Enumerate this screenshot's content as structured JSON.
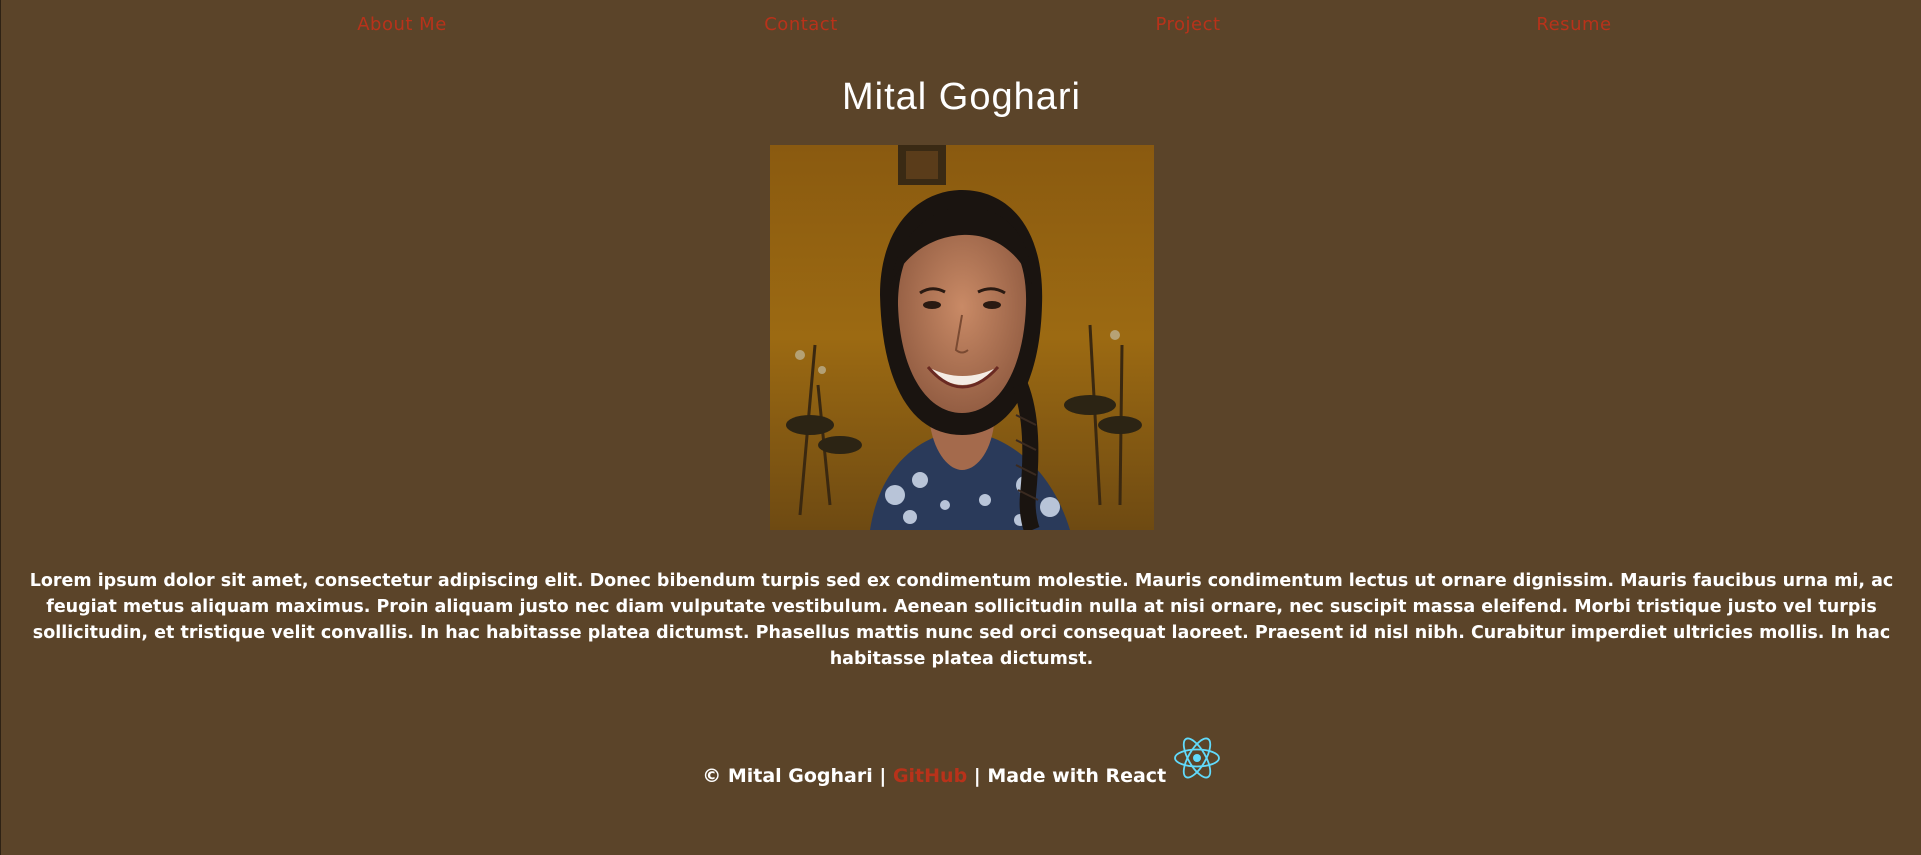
{
  "nav": {
    "items": [
      {
        "label": "About Me"
      },
      {
        "label": "Contact"
      },
      {
        "label": "Project"
      },
      {
        "label": "Resume"
      }
    ],
    "link_color": "#b8321a"
  },
  "header": {
    "title": "Mital Goghari"
  },
  "profile_photo": {
    "alt": "Mital Goghari"
  },
  "main": {
    "bio": "Lorem ipsum dolor sit amet, consectetur adipiscing elit. Donec bibendum turpis sed ex condimentum molestie. Mauris condimentum lectus ut ornare dignissim. Mauris faucibus urna mi, ac feugiat metus aliquam maximus. Proin aliquam justo nec diam vulputate vestibulum. Aenean sollicitudin nulla at nisi ornare, nec suscipit massa eleifend. Morbi tristique justo vel turpis sollicitudin, et tristique velit convallis. In hac habitasse platea dictumst. Phasellus mattis nunc sed orci consequat laoreet. Praesent id nisl nibh. Curabitur imperdiet ultricies mollis. In hac habitasse platea dictumst."
  },
  "footer": {
    "copyright": "© Mital Goghari |",
    "github_label": "GitHub",
    "made_with": "| Made with React",
    "react_icon": "react-logo-icon",
    "react_color": "#61dafb"
  },
  "colors": {
    "background": "#5b4429",
    "accent": "#b8321a",
    "text": "#ffffff"
  }
}
